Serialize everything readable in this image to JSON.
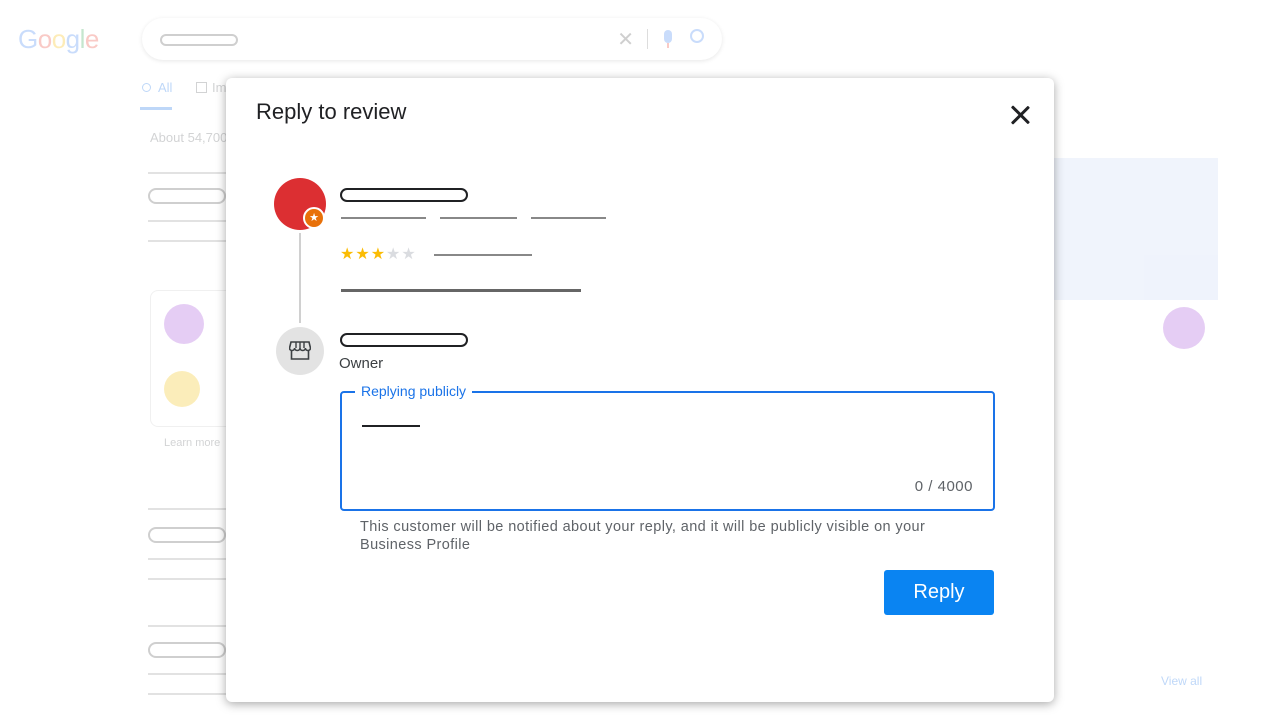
{
  "background": {
    "logo_text": "Google",
    "logo_colors": [
      "#4285f4",
      "#ea4335",
      "#fbbc05",
      "#4285f4",
      "#34a853",
      "#ea4335"
    ],
    "tabs": [
      {
        "label": "All"
      },
      {
        "label": "Im"
      }
    ],
    "results_stats": "About 54,700",
    "learn_more": "Learn more",
    "view_all": "View all"
  },
  "dialog": {
    "title": "Reply to review",
    "reviewer": {
      "avatar_color": "#dc2f32",
      "badge_icon": "local-guide-star-icon",
      "rating": 3,
      "max_rating": 5
    },
    "owner": {
      "icon": "storefront-icon",
      "label": "Owner"
    },
    "reply_field": {
      "label": "Replying publicly",
      "value": "",
      "counter": "0 / 4000"
    },
    "notice": "This customer will be notified about your reply, and it will be publicly visible on your Business Profile",
    "reply_button": "Reply",
    "accent_color": "#1a73e8",
    "button_color": "#0a84f2"
  }
}
